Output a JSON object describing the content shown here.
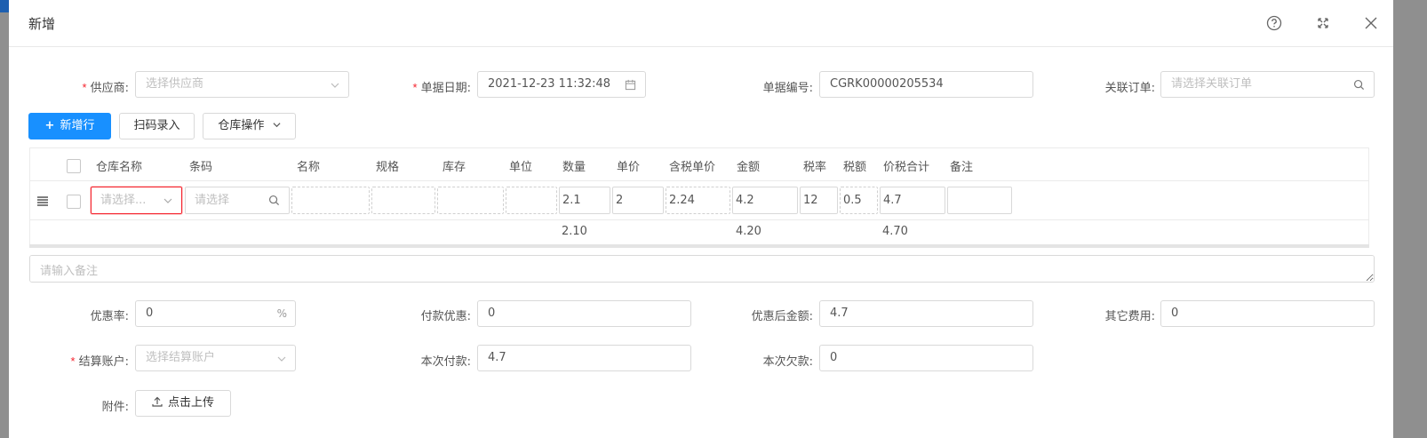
{
  "dialog": {
    "title": "新增",
    "icons": [
      "help-icon",
      "fullscreen-icon",
      "close-icon"
    ]
  },
  "form_top": {
    "supplier": {
      "label": "供应商:",
      "placeholder": "选择供应商",
      "required": true
    },
    "date": {
      "label": "单据日期:",
      "value": "2021-12-23 11:32:48",
      "required": true
    },
    "doc_no": {
      "label": "单据编号:",
      "value": "CGRK00000205534"
    },
    "order": {
      "label": "关联订单:",
      "placeholder": "请选择关联订单"
    }
  },
  "toolbar": {
    "add_row": "新增行",
    "scan": "扫码录入",
    "warehouse_ops": "仓库操作"
  },
  "table": {
    "columns": [
      "仓库名称",
      "条码",
      "名称",
      "规格",
      "库存",
      "单位",
      "数量",
      "单价",
      "含税单价",
      "金额",
      "税率",
      "税额",
      "价税合计",
      "备注"
    ],
    "row": {
      "warehouse_placeholder": "请选择...",
      "barcode_placeholder": "请选择",
      "qty": "2.1",
      "price": "2",
      "tax_price": "2.24",
      "amount": "4.2",
      "tax_rate": "12",
      "tax": "0.5",
      "total": "4.7"
    },
    "summary": {
      "qty": "2.10",
      "amount": "4.20",
      "total": "4.70"
    }
  },
  "remark_placeholder": "请输入备注",
  "form_bottom": {
    "discount_rate": {
      "label": "优惠率:",
      "value": "0",
      "suffix": "%"
    },
    "payment_discount": {
      "label": "付款优惠:",
      "value": "0"
    },
    "after_discount": {
      "label": "优惠后金额:",
      "value": "4.7"
    },
    "other_fee": {
      "label": "其它费用:",
      "value": "0"
    },
    "account": {
      "label": "结算账户:",
      "placeholder": "选择结算账户",
      "required": true
    },
    "this_payment": {
      "label": "本次付款:",
      "value": "4.7"
    },
    "this_debt": {
      "label": "本次欠款:",
      "value": "0"
    },
    "attachment": {
      "label": "附件:",
      "button": "点击上传"
    }
  },
  "colors": {
    "primary": "#1890ff",
    "required": "#f5222d",
    "error_border": "#f5222d"
  }
}
